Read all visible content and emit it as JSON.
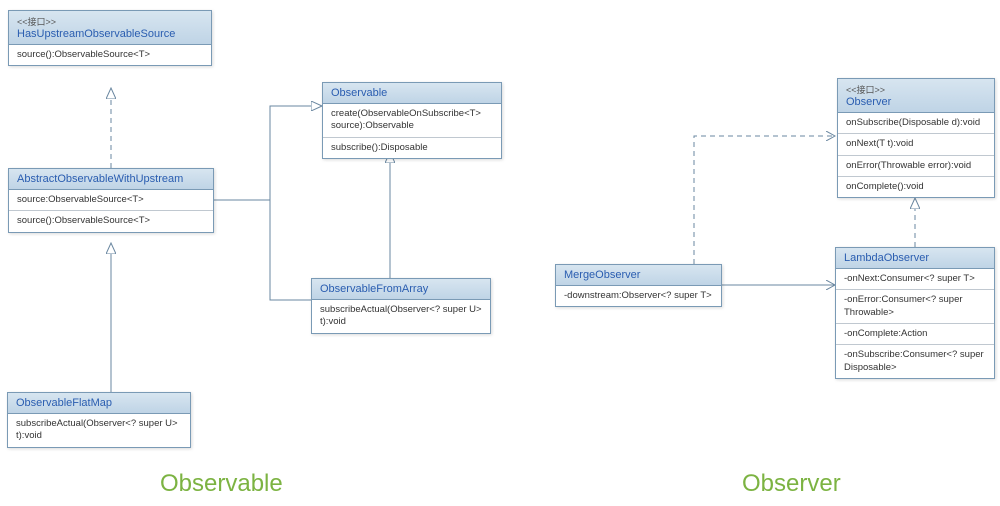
{
  "boxes": {
    "hasUpstream": {
      "stereotype": "<<接口>>",
      "title": "HasUpstreamObservableSource",
      "rows": [
        "source():ObservableSource<T>"
      ]
    },
    "abstractUp": {
      "title": "AbstractObservableWithUpstream",
      "rows": [
        "source:ObservableSource<T>",
        "source():ObservableSource<T>"
      ]
    },
    "flatMap": {
      "title": "ObservableFlatMap",
      "rows": [
        "subscribeActual(Observer<? super U> t):void"
      ]
    },
    "observable": {
      "title": "Observable",
      "rows": [
        "create(ObservableOnSubscribe<T> source):Observable",
        "subscribe():Disposable"
      ]
    },
    "fromArray": {
      "title": "ObservableFromArray",
      "rows": [
        "subscribeActual(Observer<? super U> t):void"
      ]
    },
    "mergeObs": {
      "title": "MergeObserver",
      "rows": [
        "-downstream:Observer<? super T>"
      ]
    },
    "observer": {
      "stereotype": "<<接口>>",
      "title": "Observer",
      "rows": [
        "onSubscribe(Disposable d):void",
        "onNext(T t):void",
        "onError(Throwable error):void",
        "onComplete():void"
      ]
    },
    "lambdaObs": {
      "title": "LambdaObserver",
      "rows": [
        "-onNext:Consumer<? super T>",
        "-onError:Consumer<? super Throwable>",
        "-onComplete:Action",
        "-onSubscribe:Consumer<? super Disposable>"
      ]
    }
  },
  "labels": {
    "observable": "Observable",
    "observer": "Observer"
  }
}
